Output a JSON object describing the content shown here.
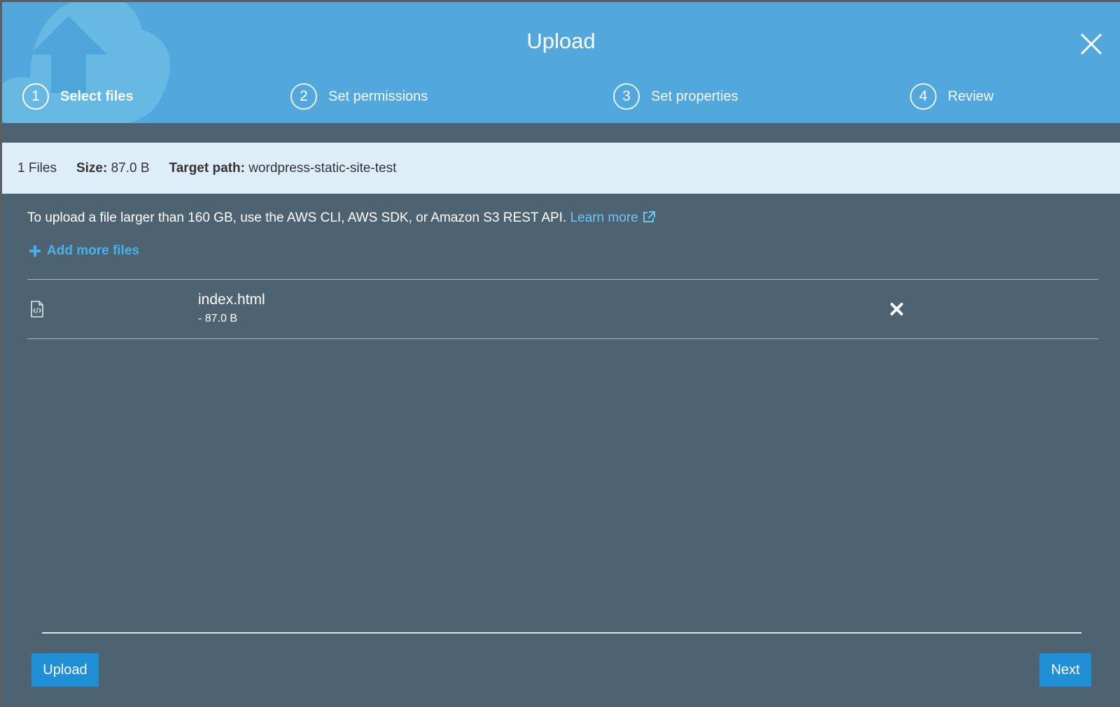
{
  "header": {
    "title": "Upload",
    "close_icon": "close-icon",
    "background_icon": "cloud-upload-icon"
  },
  "steps": [
    {
      "number": "1",
      "label": "Select files",
      "active": true
    },
    {
      "number": "2",
      "label": "Set permissions",
      "active": false
    },
    {
      "number": "3",
      "label": "Set properties",
      "active": false
    },
    {
      "number": "4",
      "label": "Review",
      "active": false
    }
  ],
  "summary": {
    "files": "1 Files",
    "size_label": "Size:",
    "size_value": "87.0 B",
    "target_label": "Target path:",
    "target_value": "wordpress-static-site-test"
  },
  "notice": {
    "text": "To upload a file larger than 160 GB, use the AWS CLI, AWS SDK, or Amazon S3 REST API.",
    "link_label": "Learn more"
  },
  "add_more": {
    "label": "Add more files"
  },
  "files": [
    {
      "name": "index.html",
      "size": "- 87.0 B",
      "icon": "file-code-icon"
    }
  ],
  "footer": {
    "upload_label": "Upload",
    "next_label": "Next"
  },
  "colors": {
    "header": "#52a8dc",
    "body": "#4e6372",
    "infobar": "#ddeef8",
    "button": "#1f8fd6",
    "link": "#6fc4f2"
  }
}
